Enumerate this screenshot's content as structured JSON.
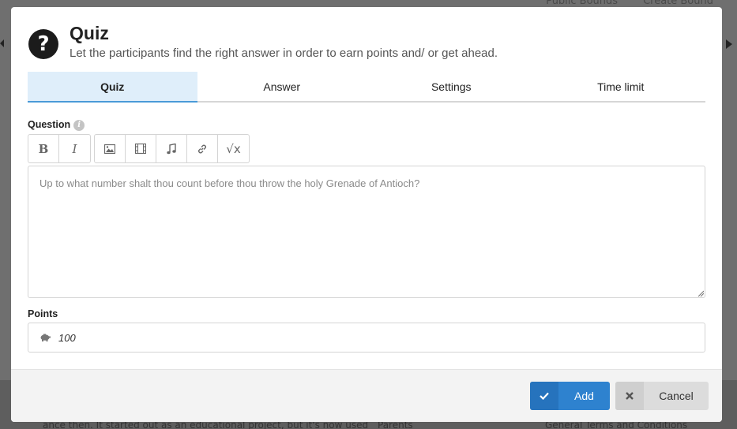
{
  "background": {
    "nav": [
      "Public Bounds",
      "Create Bound"
    ],
    "footer_text": "ance then. It started out as an educational project, but it's now used",
    "footer_link1": "Parents",
    "footer_link2": "General Terms and Conditions"
  },
  "modal": {
    "title": "Quiz",
    "subtitle": "Let the participants find the right answer in order to earn points and/ or get ahead.",
    "tabs": [
      {
        "label": "Quiz",
        "active": true
      },
      {
        "label": "Answer",
        "active": false
      },
      {
        "label": "Settings",
        "active": false
      },
      {
        "label": "Time limit",
        "active": false
      }
    ],
    "question": {
      "label": "Question",
      "placeholder": "Up to what number shalt thou count before thou throw the holy Grenade of Antioch?",
      "toolbar": {
        "bold": "B",
        "italic": "I",
        "math": "√x"
      }
    },
    "points": {
      "label": "Points",
      "value": "100"
    },
    "footer": {
      "add_label": "Add",
      "cancel_label": "Cancel"
    }
  },
  "colors": {
    "accent": "#2e82cf",
    "active_tab_bg": "#dfeefa",
    "active_tab_border": "#4a9ad8"
  }
}
